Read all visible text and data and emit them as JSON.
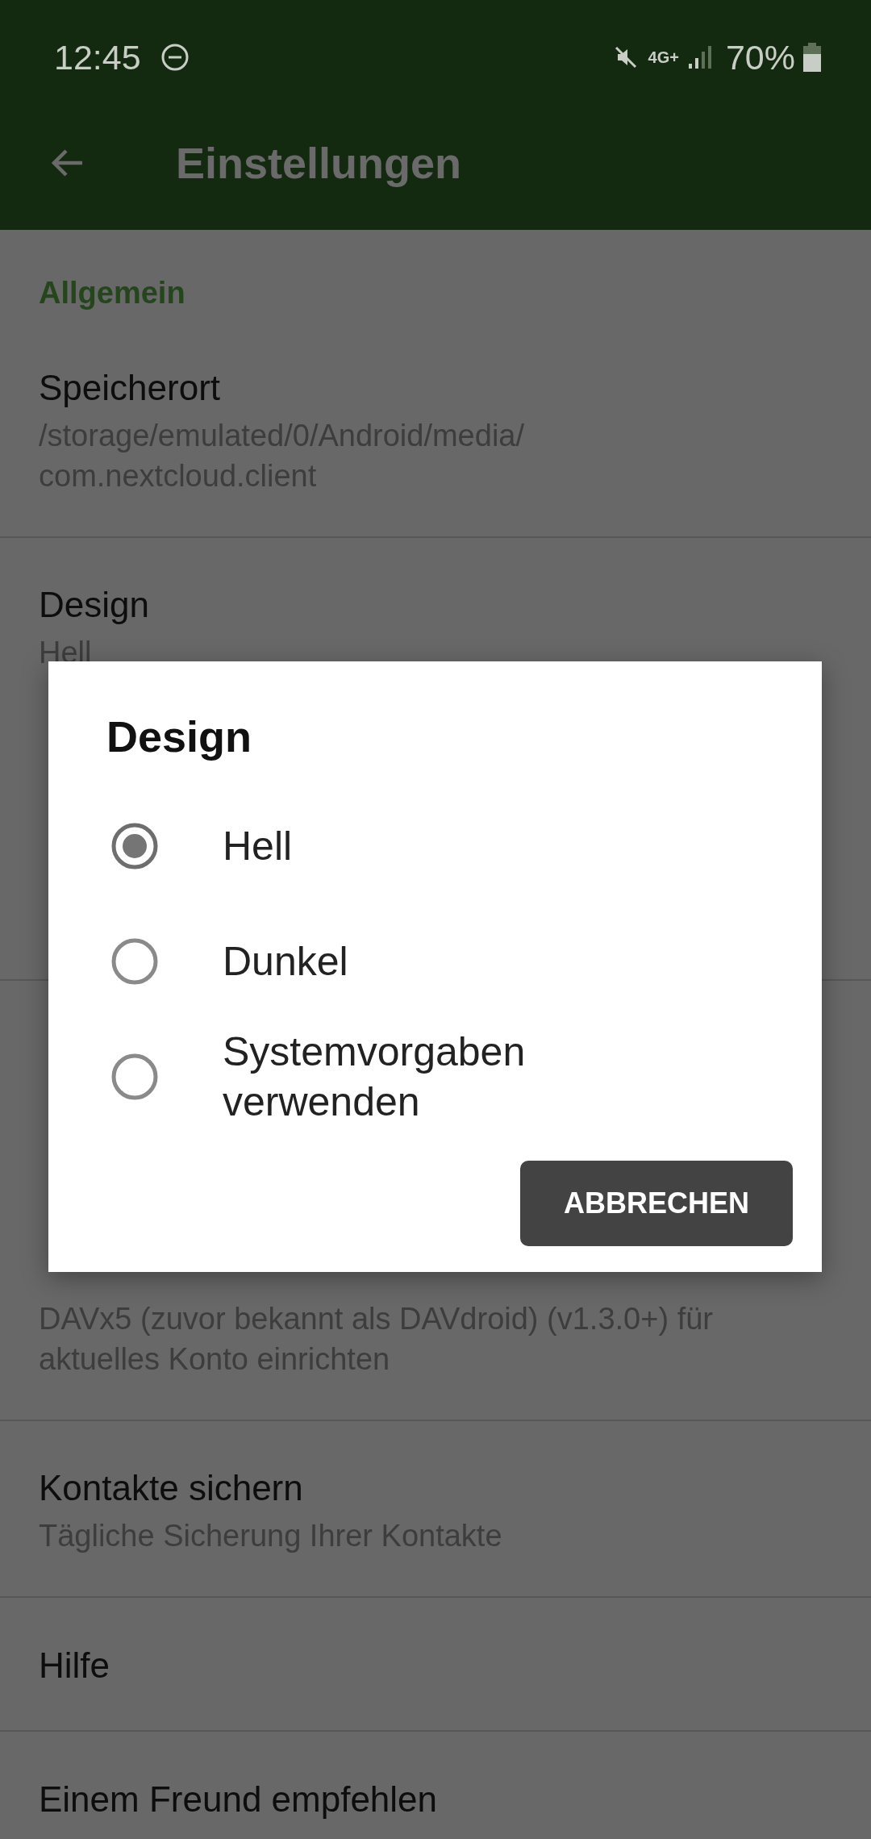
{
  "status_bar": {
    "time": "12:45",
    "network": "4G+",
    "battery": "70%"
  },
  "app_bar": {
    "title": "Einstellungen"
  },
  "preferences": [
    {
      "kind": "header",
      "title": "Allgemein"
    },
    {
      "kind": "item",
      "title": "Speicherort",
      "summary": "/storage/emulated/0/Android/media/\ncom.nextcloud.client"
    },
    {
      "kind": "item",
      "title": "Design",
      "summary": "Hell"
    },
    {
      "kind": "covered_header"
    },
    {
      "kind": "covered_item_with_summary"
    },
    {
      "kind": "covered_item"
    },
    {
      "kind": "covered_header"
    },
    {
      "kind": "item",
      "summary": "DAVx5 (zuvor bekannt als DAVdroid) (v1.3.0+) für\naktuelles Konto einrichten"
    },
    {
      "kind": "item",
      "title": "Kontakte sichern",
      "summary": "Tägliche Sicherung Ihrer Kontakte"
    },
    {
      "kind": "item",
      "title": "Hilfe"
    },
    {
      "kind": "item",
      "title": "Einem Freund empfehlen"
    }
  ],
  "dialog": {
    "title": "Design",
    "options": [
      {
        "label": "Hell",
        "selected": true
      },
      {
        "label": "Dunkel",
        "selected": false
      },
      {
        "label": "Systemvorgaben\nverwenden",
        "selected": false
      }
    ],
    "button": "ABBRECHEN"
  }
}
